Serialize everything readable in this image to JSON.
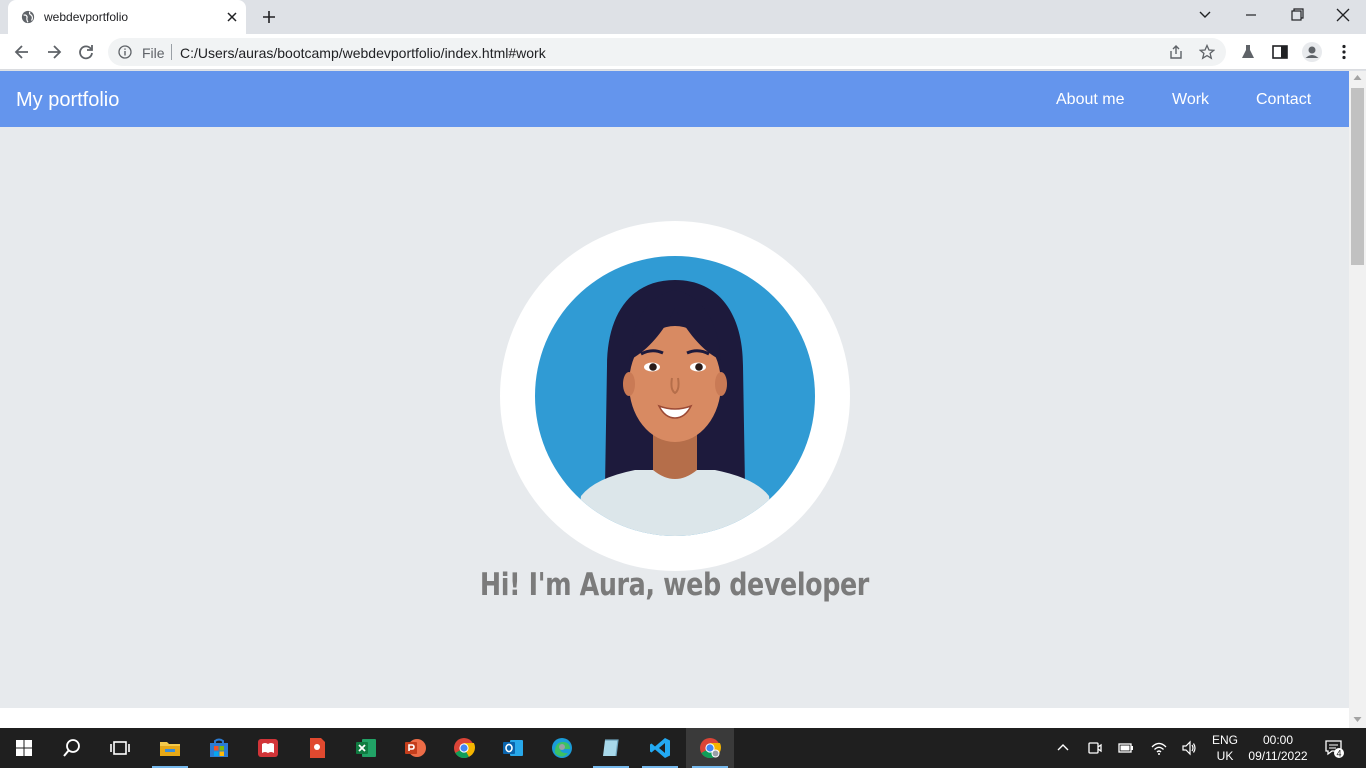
{
  "browser": {
    "tab": {
      "title": "webdevportfolio",
      "favicon": "globe-icon"
    },
    "address": {
      "scheme_label": "File",
      "url": "C:/Users/auras/bootcamp/webdevportfolio/index.html#work"
    }
  },
  "page": {
    "brand": "My portfolio",
    "nav": [
      {
        "label": "About me"
      },
      {
        "label": "Work"
      },
      {
        "label": "Contact"
      }
    ],
    "hero_text": "Hi! I'm Aura, web developer",
    "colors": {
      "navbar": "#6495ed",
      "background": "#e7eaed",
      "hero_text": "#7b7b7b"
    }
  },
  "taskbar": {
    "apps": [
      "windows-start-icon",
      "search-icon",
      "task-view-icon",
      "file-explorer-icon",
      "microsoft-store-icon",
      "reader-icon",
      "document-app-icon",
      "excel-icon",
      "powerpoint-icon",
      "chrome-icon",
      "outlook-icon",
      "edge-icon",
      "app-icon",
      "vscode-icon",
      "chrome-profile-icon"
    ],
    "language": {
      "line1": "ENG",
      "line2": "UK"
    },
    "clock": {
      "time": "00:00",
      "date": "09/11/2022"
    },
    "notifications": "4"
  }
}
